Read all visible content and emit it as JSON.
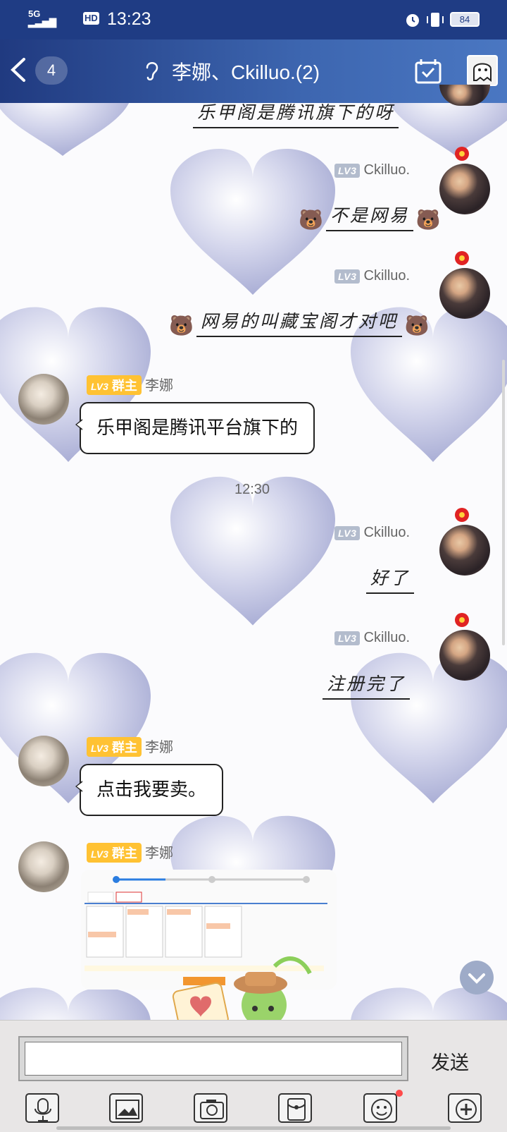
{
  "status_bar": {
    "network": "5G",
    "hd": "HD",
    "time": "13:23",
    "battery": "84"
  },
  "header": {
    "unread_count": "4",
    "title": "李娜、Ckilluo.(2)"
  },
  "messages": [
    {
      "sender": "",
      "text": "乐甲阁是腾讯旗下的呀",
      "style": "handwritten-right"
    },
    {
      "sender": "Ckilluo.",
      "level": "LV3",
      "text": "不是网易",
      "style": "handwritten-right"
    },
    {
      "sender": "Ckilluo.",
      "level": "LV3",
      "text": "网易的叫藏宝阁才对吧",
      "style": "handwritten-right"
    },
    {
      "sender": "李娜",
      "level": "LV3",
      "role": "群主",
      "text": "乐甲阁是腾讯平台旗下的",
      "style": "bubble-left"
    },
    {
      "sender": "Ckilluo.",
      "level": "LV3",
      "text": "好了",
      "style": "handwritten-right"
    },
    {
      "sender": "Ckilluo.",
      "level": "LV3",
      "text": "注册完了",
      "style": "handwritten-right"
    },
    {
      "sender": "李娜",
      "level": "LV3",
      "role": "群主",
      "text": "点击我要卖。",
      "style": "bubble-left"
    },
    {
      "sender": "李娜",
      "level": "LV3",
      "role": "群主",
      "text": "",
      "style": "image-left"
    }
  ],
  "timestamp_divider": "12:30",
  "input": {
    "placeholder": "",
    "send_label": "发送"
  },
  "toolbar": [
    "microphone-icon",
    "image-icon",
    "camera-icon",
    "red-packet-icon",
    "emoji-icon",
    "plus-icon"
  ],
  "colors": {
    "status_bar": "#1f3c84",
    "header_start": "#203a80",
    "header_end": "#4a77c2",
    "owner_tag": "#ffc233",
    "level_tag": "#b3bccd",
    "emoji_dot": "#ff4a4a"
  }
}
